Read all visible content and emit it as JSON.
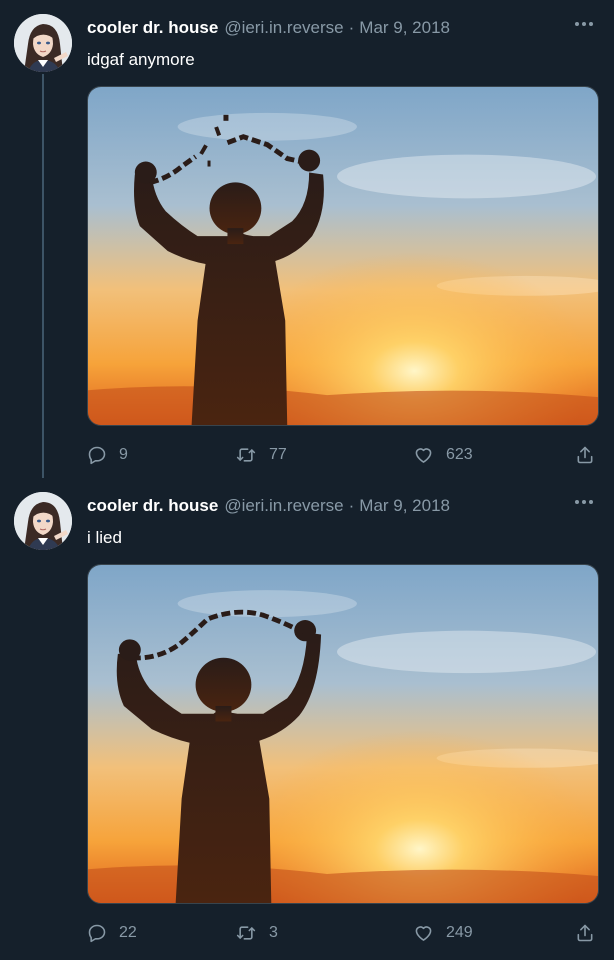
{
  "tweets": [
    {
      "display_name": "cooler dr. house",
      "handle": "@ieri.in.reverse",
      "separator": "·",
      "date": "Mar 9, 2018",
      "text": "idgaf anymore",
      "media_icon": "image",
      "reply_count": "9",
      "retweet_count": "77",
      "like_count": "623"
    },
    {
      "display_name": "cooler dr. house",
      "handle": "@ieri.in.reverse",
      "separator": "·",
      "date": "Mar 9, 2018",
      "text": "i lied",
      "media_icon": "image",
      "reply_count": "22",
      "retweet_count": "3",
      "like_count": "249"
    }
  ],
  "icons": {
    "more": "more-horizontal-icon",
    "reply": "reply-icon",
    "retweet": "retweet-icon",
    "like": "heart-icon",
    "share": "share-icon"
  },
  "colors": {
    "background": "#15202b",
    "secondary_text": "#8899a6",
    "thread_line": "#3d5466",
    "border": "#38444d"
  }
}
